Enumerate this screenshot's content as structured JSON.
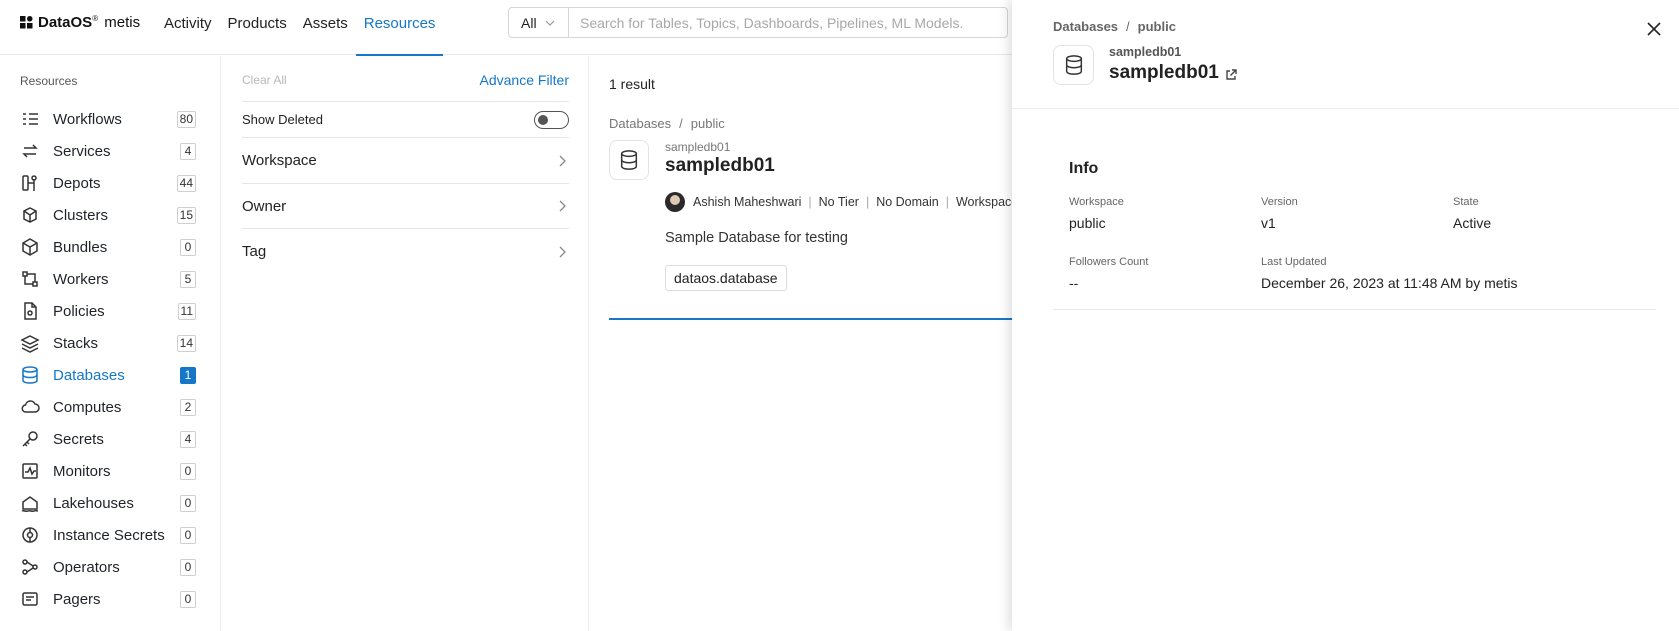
{
  "logo": {
    "brand": "DataOS",
    "reg": "®",
    "product": "metis"
  },
  "nav": {
    "items": [
      {
        "label": "Activity"
      },
      {
        "label": "Products"
      },
      {
        "label": "Assets"
      },
      {
        "label": "Resources",
        "active": true
      }
    ]
  },
  "search": {
    "scope": "All",
    "placeholder": "Search for Tables, Topics, Dashboards, Pipelines, ML Models."
  },
  "sidebar": {
    "title": "Resources",
    "items": [
      {
        "label": "Workflows",
        "count": "80",
        "icon": "workflows-icon"
      },
      {
        "label": "Services",
        "count": "4",
        "icon": "services-icon"
      },
      {
        "label": "Depots",
        "count": "44",
        "icon": "depots-icon"
      },
      {
        "label": "Clusters",
        "count": "15",
        "icon": "clusters-icon"
      },
      {
        "label": "Bundles",
        "count": "0",
        "icon": "bundles-icon"
      },
      {
        "label": "Workers",
        "count": "5",
        "icon": "workers-icon"
      },
      {
        "label": "Policies",
        "count": "11",
        "icon": "policies-icon"
      },
      {
        "label": "Stacks",
        "count": "14",
        "icon": "stacks-icon"
      },
      {
        "label": "Databases",
        "count": "1",
        "icon": "databases-icon",
        "active": true
      },
      {
        "label": "Computes",
        "count": "2",
        "icon": "computes-icon"
      },
      {
        "label": "Secrets",
        "count": "4",
        "icon": "secrets-icon"
      },
      {
        "label": "Monitors",
        "count": "0",
        "icon": "monitors-icon"
      },
      {
        "label": "Lakehouses",
        "count": "0",
        "icon": "lakehouses-icon"
      },
      {
        "label": "Instance Secrets",
        "count": "0",
        "icon": "instance-secrets-icon"
      },
      {
        "label": "Operators",
        "count": "0",
        "icon": "operators-icon"
      },
      {
        "label": "Pagers",
        "count": "0",
        "icon": "pagers-icon"
      }
    ]
  },
  "filters": {
    "clear_all": "Clear All",
    "advance_filter": "Advance Filter",
    "show_deleted": "Show Deleted",
    "show_deleted_on": false,
    "groups": [
      {
        "label": "Workspace"
      },
      {
        "label": "Owner"
      },
      {
        "label": "Tag"
      }
    ]
  },
  "results": {
    "count_text": "1 result",
    "breadcrumb": [
      "Databases",
      "public"
    ],
    "card": {
      "subtitle": "sampledb01",
      "title": "sampledb01",
      "owner": "Ashish Maheshwari",
      "tier": "No Tier",
      "domain": "No Domain",
      "workspace": "Workspace",
      "description": "Sample Database for testing",
      "tag": "dataos.database"
    }
  },
  "drawer": {
    "breadcrumb": [
      "Databases",
      "public"
    ],
    "subtitle": "sampledb01",
    "title": "sampledb01",
    "info": {
      "heading": "Info",
      "workspace_label": "Workspace",
      "workspace_value": "public",
      "version_label": "Version",
      "version_value": "v1",
      "state_label": "State",
      "state_value": "Active",
      "followers_label": "Followers Count",
      "followers_value": "--",
      "updated_label": "Last Updated",
      "updated_value": "December 26, 2023 at 11:48 AM by metis"
    }
  },
  "colors": {
    "accent": "#1677c9"
  }
}
